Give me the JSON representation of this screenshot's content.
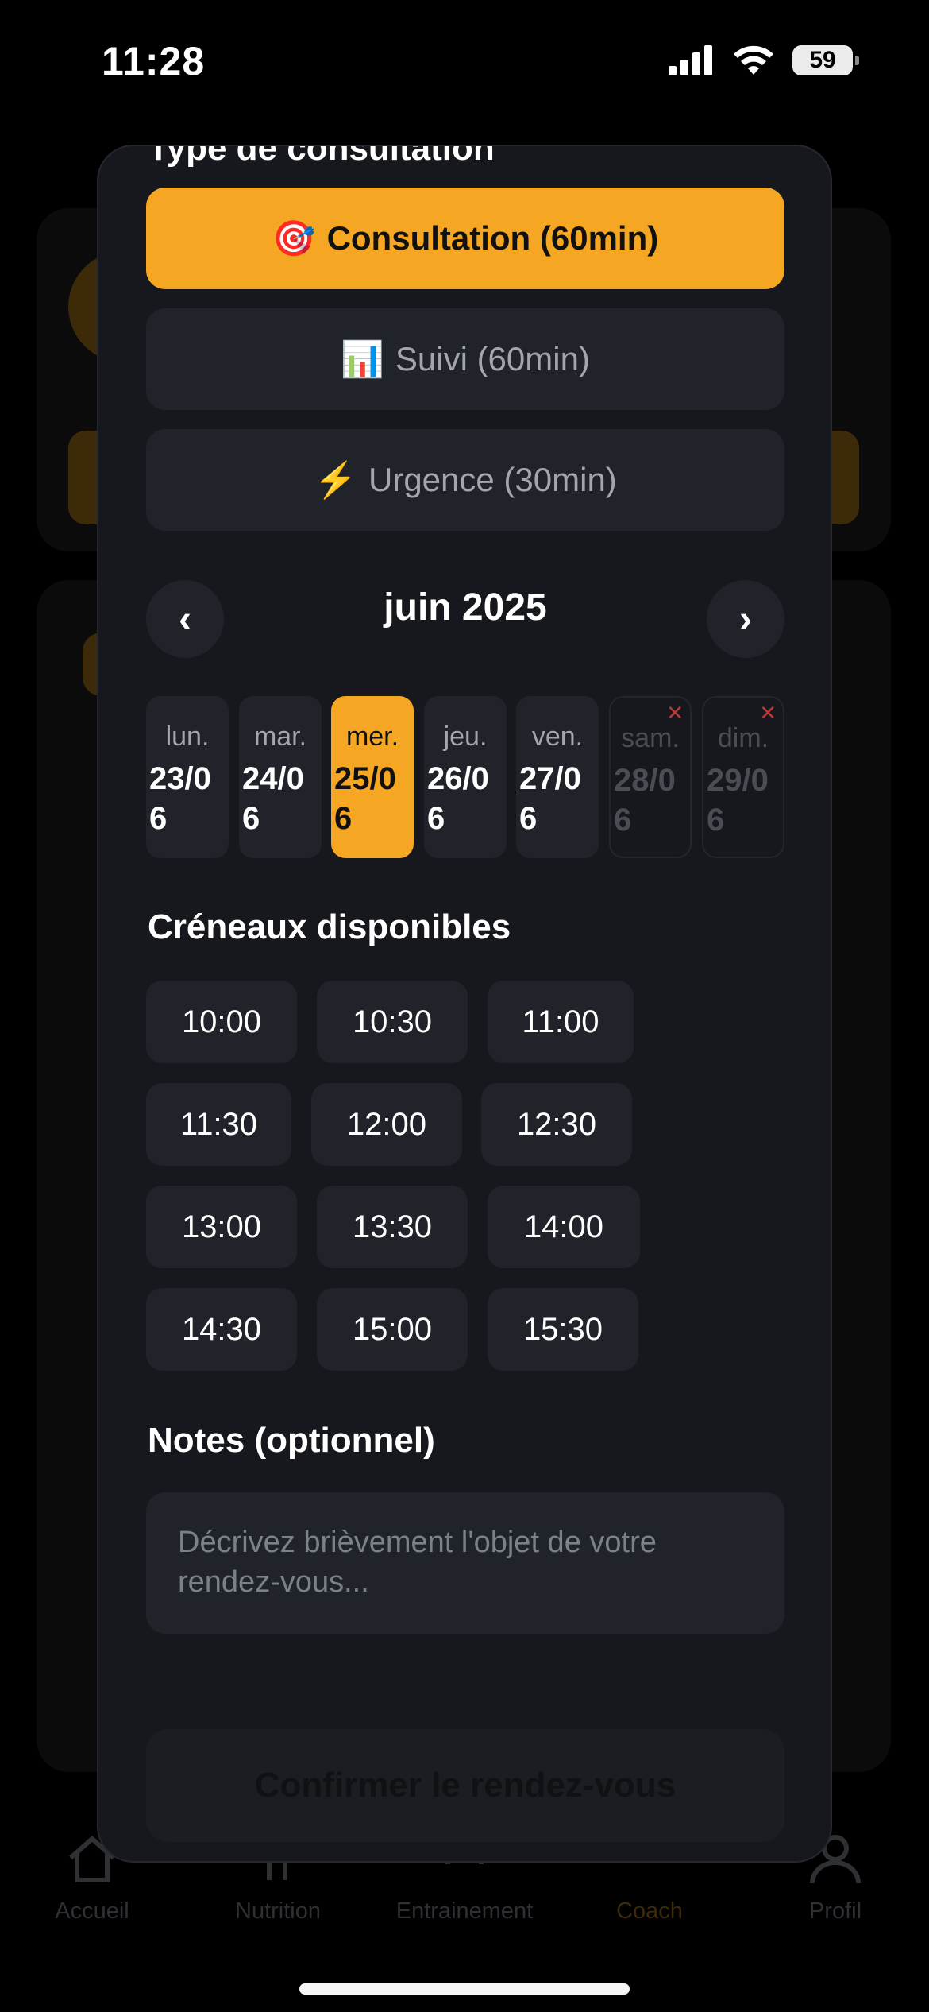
{
  "status_bar": {
    "time": "11:28",
    "battery": "59"
  },
  "tabbar": {
    "items": [
      {
        "label": "Accueil",
        "icon": "home-icon"
      },
      {
        "label": "Nutrition",
        "icon": "fork-knife-icon"
      },
      {
        "label": "Entrainement",
        "icon": "dumbbell-icon"
      },
      {
        "label": "Coach",
        "icon": "coach-icon",
        "active": true
      },
      {
        "label": "Profil",
        "icon": "person-icon"
      }
    ]
  },
  "modal": {
    "section_title": "Type de consultation",
    "types": [
      {
        "emoji": "🎯",
        "label": "Consultation (60min)",
        "selected": true
      },
      {
        "emoji": "📊",
        "label": "Suivi (60min)"
      },
      {
        "emoji": "⚡",
        "label": "Urgence (30min)"
      }
    ],
    "calendar": {
      "month": "juin 2025",
      "prev": "‹",
      "next": "›",
      "days": [
        {
          "name": "lun.",
          "date": "23/06"
        },
        {
          "name": "mar.",
          "date": "24/06"
        },
        {
          "name": "mer.",
          "date": "25/06",
          "selected": true
        },
        {
          "name": "jeu.",
          "date": "26/06"
        },
        {
          "name": "ven.",
          "date": "27/06"
        },
        {
          "name": "sam.",
          "date": "28/06",
          "disabled": true
        },
        {
          "name": "dim.",
          "date": "29/06",
          "disabled": true
        }
      ],
      "unavailable_mark": "✕"
    },
    "slots_title": "Créneaux disponibles",
    "slots": [
      "10:00",
      "10:30",
      "11:00",
      "11:30",
      "12:00",
      "12:30",
      "13:00",
      "13:30",
      "14:00",
      "14:30",
      "15:00",
      "15:30"
    ],
    "notes_title": "Notes (optionnel)",
    "notes_placeholder": "Décrivez brièvement l'objet de votre rendez-vous...",
    "confirm_label": "Confirmer le rendez-vous"
  },
  "colors": {
    "accent": "#f5a623",
    "modal_bg": "#16181d",
    "button_bg": "#20232a"
  }
}
